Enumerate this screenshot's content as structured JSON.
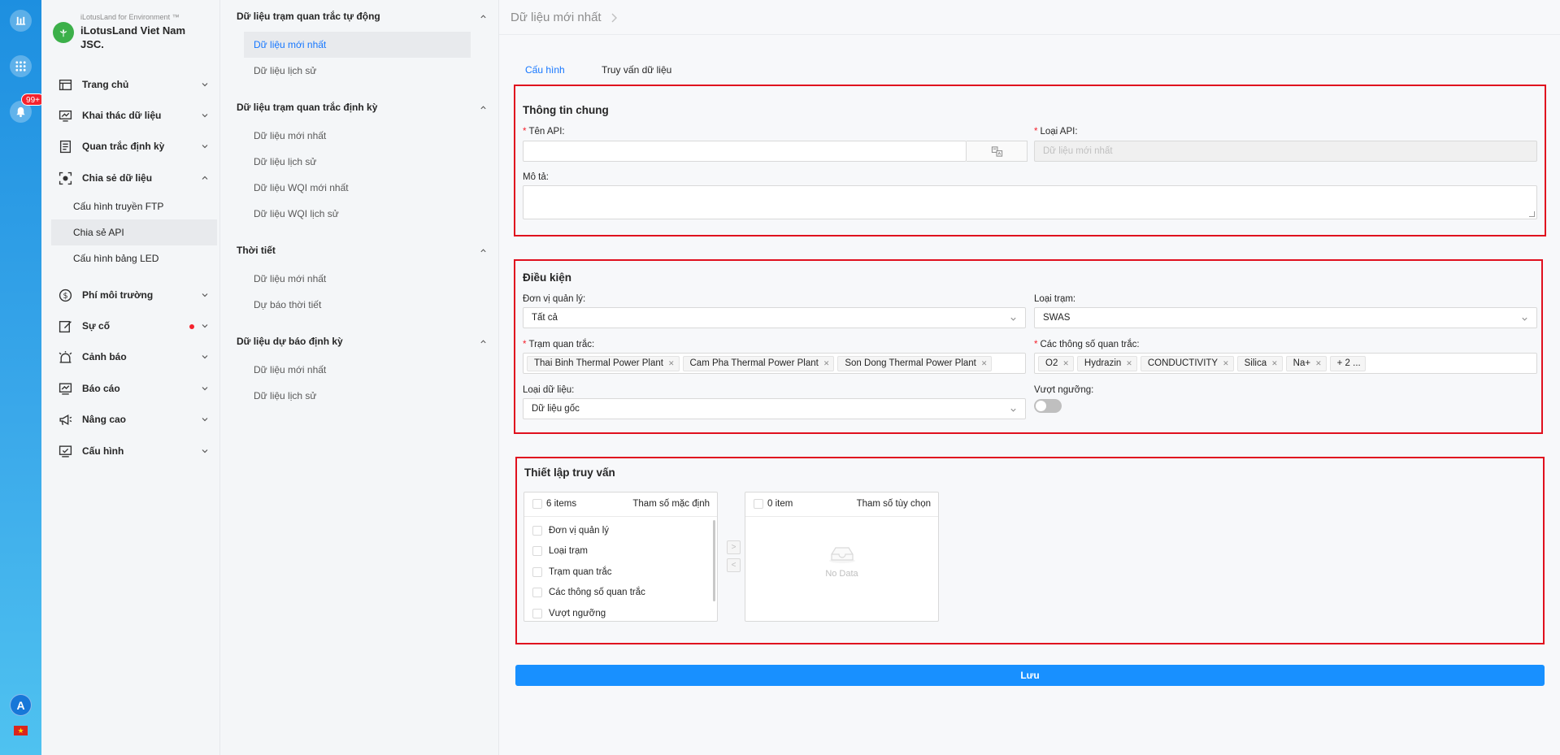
{
  "rail": {
    "badge": "99+",
    "avatar": "A",
    "flag": "★"
  },
  "brand": {
    "small": "iLotusLand for Environment ™",
    "name": "iLotusLand Viet Nam JSC."
  },
  "menu": [
    {
      "label": "Trang chủ",
      "icon": "home-icon"
    },
    {
      "label": "Khai thác dữ liệu",
      "icon": "monitor-data-icon"
    },
    {
      "label": "Quan trắc định kỳ",
      "icon": "clipboard-icon"
    },
    {
      "label": "Chia sẻ dữ liệu",
      "icon": "share-focus-icon"
    },
    {
      "label": "Phí môi trường",
      "icon": "dollar-icon"
    },
    {
      "label": "Sự cố",
      "icon": "edit-icon"
    },
    {
      "label": "Cảnh báo",
      "icon": "alarm-icon"
    },
    {
      "label": "Báo cáo",
      "icon": "report-icon"
    },
    {
      "label": "Nâng cao",
      "icon": "megaphone-icon"
    },
    {
      "label": "Cấu hình",
      "icon": "settings-monitor-icon"
    }
  ],
  "share_submenu": [
    "Cấu hình truyền FTP",
    "Chia sẻ API",
    "Cấu hình bảng LED"
  ],
  "subnav": [
    {
      "title": "Dữ liệu trạm quan trắc tự động",
      "items": [
        "Dữ liệu mới nhất",
        "Dữ liệu lịch sử"
      ]
    },
    {
      "title": "Dữ liệu trạm quan trắc định kỳ",
      "items": [
        "Dữ liệu mới nhất",
        "Dữ liệu lịch sử",
        "Dữ liệu WQI mới nhất",
        "Dữ liệu WQI lịch sử"
      ]
    },
    {
      "title": "Thời tiết",
      "items": [
        "Dữ liệu mới nhất",
        "Dự báo thời tiết"
      ]
    },
    {
      "title": "Dữ liệu dự báo định kỳ",
      "items": [
        "Dữ liệu mới nhất",
        "Dữ liệu lịch sử"
      ]
    }
  ],
  "breadcrumb": "Dữ liệu mới nhất",
  "tabs": [
    "Cấu hình",
    "Truy vấn dữ liệu"
  ],
  "general": {
    "title": "Thông tin chung",
    "api_name_label": "Tên API:",
    "api_name_value": "",
    "api_type_label": "Loại API:",
    "api_type_placeholder": "Dữ liệu mới nhất",
    "desc_label": "Mô tả:"
  },
  "conditions": {
    "title": "Điều kiện",
    "unit_label": "Đơn vị quản lý:",
    "unit_value": "Tất cả",
    "station_type_label": "Loại trạm:",
    "station_type_value": "SWAS",
    "stations_label": "Trạm quan trắc:",
    "stations": [
      "Thai Binh Thermal Power Plant",
      "Cam Pha Thermal Power Plant",
      "Son Dong Thermal Power Plant"
    ],
    "params_label": "Các thông số quan trắc:",
    "params": [
      "O2",
      "Hydrazin",
      "CONDUCTIVITY",
      "Silica",
      "Na+"
    ],
    "params_more": "+ 2 ...",
    "data_type_label": "Loại dữ liệu:",
    "data_type_value": "Dữ liệu gốc",
    "exceed_label": "Vượt ngưỡng:",
    "exceed_on": false
  },
  "query": {
    "title": "Thiết lập truy vấn",
    "left_count": "6 items",
    "left_title": "Tham số mặc định",
    "left_items": [
      "Đơn vị quản lý",
      "Loại trạm",
      "Trạm quan trắc",
      "Các thông số quan trắc",
      "Vượt ngưỡng"
    ],
    "right_count": "0 item",
    "right_title": "Tham số tùy chọn",
    "empty": "No Data",
    "move_right": ">",
    "move_left": "<"
  },
  "save_label": "Lưu"
}
